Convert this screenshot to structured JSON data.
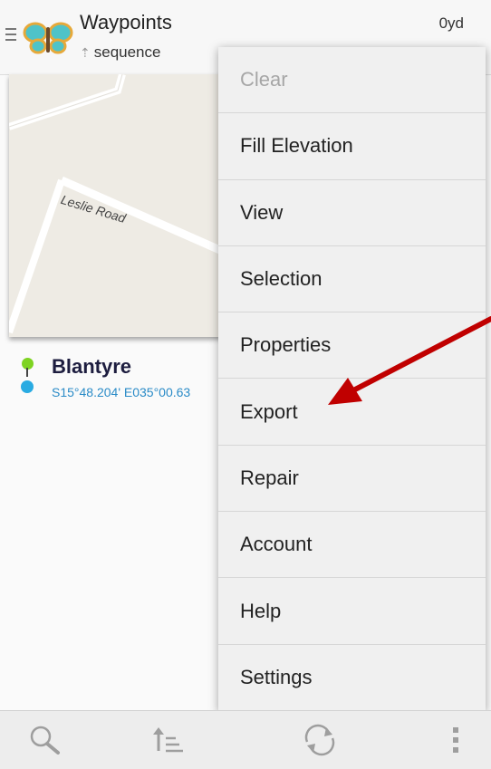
{
  "header": {
    "title": "Waypoints",
    "subtitle": "sequence",
    "distance": "0yd"
  },
  "map": {
    "road_label": "Leslie Road"
  },
  "waypoint": {
    "name": "Blantyre",
    "coords": "S15°48.204' E035°00.63"
  },
  "menu": {
    "items": [
      {
        "label": "Clear",
        "enabled": false
      },
      {
        "label": "Fill Elevation",
        "enabled": true
      },
      {
        "label": "View",
        "enabled": true
      },
      {
        "label": "Selection",
        "enabled": true
      },
      {
        "label": "Properties",
        "enabled": true
      },
      {
        "label": "Export",
        "enabled": true
      },
      {
        "label": "Repair",
        "enabled": true
      },
      {
        "label": "Account",
        "enabled": true
      },
      {
        "label": "Help",
        "enabled": true
      },
      {
        "label": "Settings",
        "enabled": true
      }
    ]
  },
  "bottom_bar": {
    "icons": [
      "search-icon",
      "sort-icon",
      "sync-icon",
      "overflow-icon"
    ]
  },
  "colors": {
    "pin_start": "#7ed321",
    "pin_end": "#29abe2",
    "annotation_arrow": "#c00000",
    "coords_text": "#2a8bc7"
  }
}
